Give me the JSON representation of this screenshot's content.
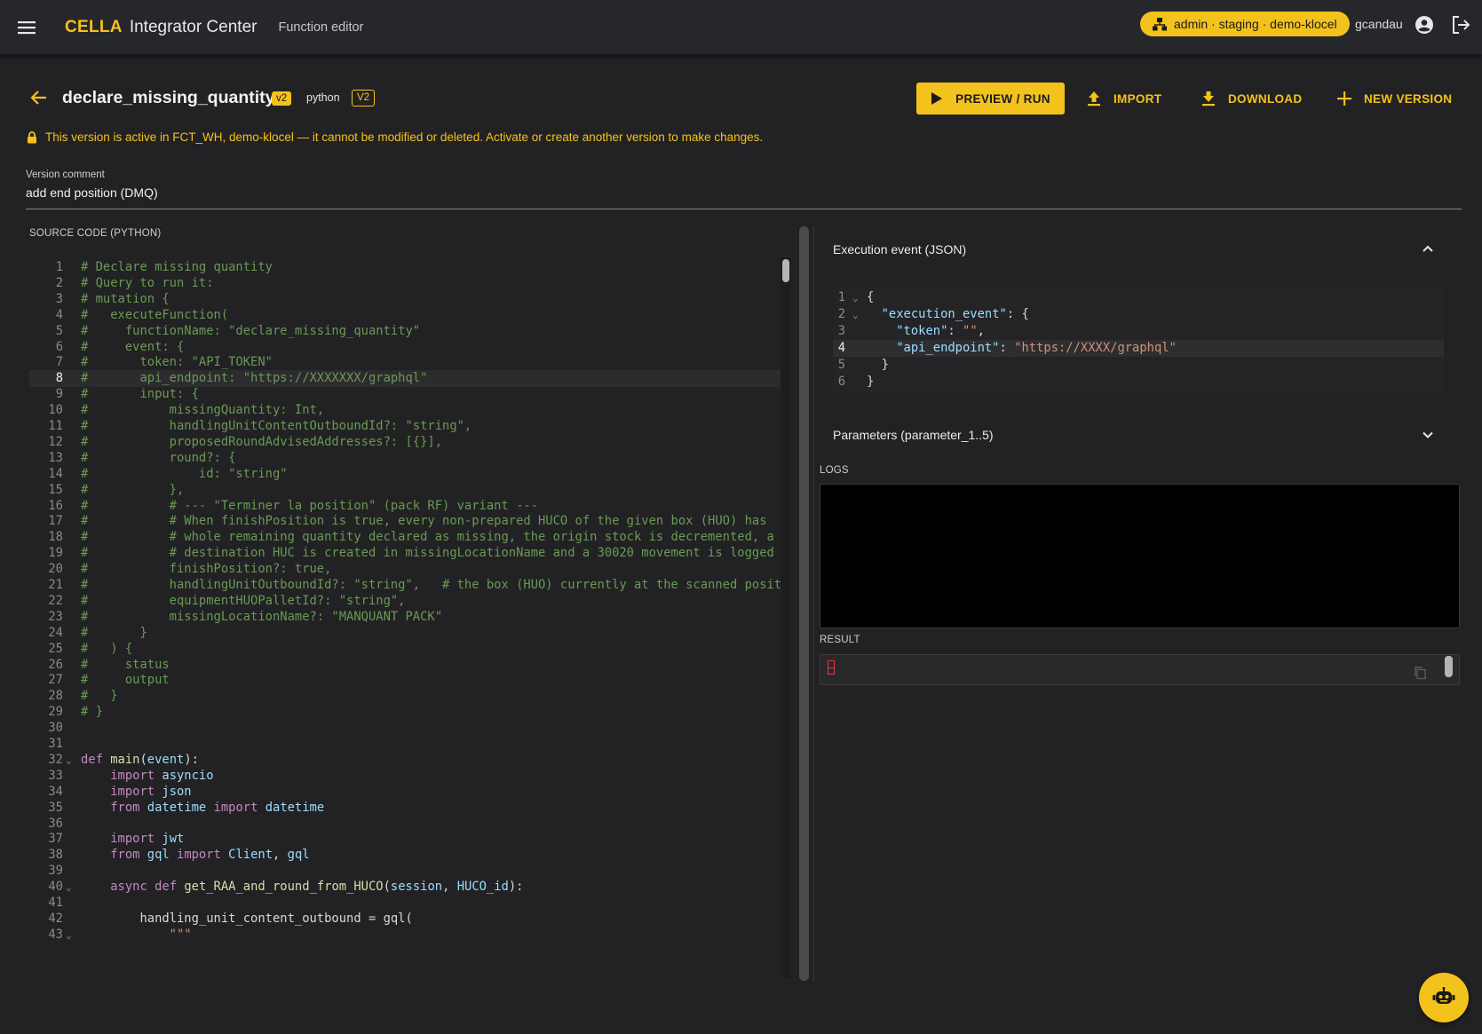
{
  "topbar": {
    "brand_strong": "CELLA",
    "brand_rest": "Integrator Center",
    "subtitle": "Function editor",
    "env_badge": "admin · staging · demo-klocel",
    "username": "gcandau"
  },
  "header": {
    "function_name": "declare_missing_quantity",
    "version_badge": "v2",
    "language": "python",
    "version_label": "V2",
    "buttons": {
      "run": "PREVIEW / RUN",
      "import": "IMPORT",
      "download": "DOWNLOAD",
      "new_version": "NEW VERSION"
    }
  },
  "warning": "This version is active in FCT_WH, demo-klocel — it cannot be modified or deleted. Activate or create another version to make changes.",
  "version_comment": {
    "label": "Version comment",
    "value": "add end position (DMQ)"
  },
  "source": {
    "label": "SOURCE CODE (PYTHON)",
    "active_line": 8,
    "lines": [
      {
        "n": "1",
        "fold": "",
        "t": "# Declare missing quantity",
        "k": "comment"
      },
      {
        "n": "2",
        "fold": "",
        "t": "# Query to run it:",
        "k": "comment"
      },
      {
        "n": "3",
        "fold": "",
        "t": "# mutation {",
        "k": "comment"
      },
      {
        "n": "4",
        "fold": "",
        "t": "#   executeFunction(",
        "k": "comment"
      },
      {
        "n": "5",
        "fold": "",
        "t": "#     functionName: \"declare_missing_quantity\"",
        "k": "comment"
      },
      {
        "n": "6",
        "fold": "",
        "t": "#     event: {",
        "k": "comment"
      },
      {
        "n": "7",
        "fold": "",
        "t": "#       token: \"API_TOKEN\"",
        "k": "comment"
      },
      {
        "n": "8",
        "fold": "",
        "t": "#       api_endpoint: \"https://XXXXXXX/graphql\"",
        "k": "comment"
      },
      {
        "n": "9",
        "fold": "",
        "t": "#       input: {",
        "k": "comment"
      },
      {
        "n": "10",
        "fold": "",
        "t": "#           missingQuantity: Int,",
        "k": "comment"
      },
      {
        "n": "11",
        "fold": "",
        "t": "#           handlingUnitContentOutboundId?: \"string\",",
        "k": "comment"
      },
      {
        "n": "12",
        "fold": "",
        "t": "#           proposedRoundAdvisedAddresses?: [{}],",
        "k": "comment"
      },
      {
        "n": "13",
        "fold": "",
        "t": "#           round?: {",
        "k": "comment"
      },
      {
        "n": "14",
        "fold": "",
        "t": "#               id: \"string\"",
        "k": "comment"
      },
      {
        "n": "15",
        "fold": "",
        "t": "#           },",
        "k": "comment"
      },
      {
        "n": "16",
        "fold": "",
        "t": "#           # --- \"Terminer la position\" (pack RF) variant ---",
        "k": "comment"
      },
      {
        "n": "17",
        "fold": "",
        "t": "#           # When finishPosition is true, every non-prepared HUCO of the given box (HUO) has",
        "k": "comment"
      },
      {
        "n": "18",
        "fold": "",
        "t": "#           # whole remaining quantity declared as missing, the origin stock is decremented, a",
        "k": "comment"
      },
      {
        "n": "19",
        "fold": "",
        "t": "#           # destination HUC is created in missingLocationName and a 30020 movement is logged",
        "k": "comment"
      },
      {
        "n": "20",
        "fold": "",
        "t": "#           finishPosition?: true,",
        "k": "comment"
      },
      {
        "n": "21",
        "fold": "",
        "t": "#           handlingUnitOutboundId?: \"string\",   # the box (HUO) currently at the scanned position",
        "k": "comment"
      },
      {
        "n": "22",
        "fold": "",
        "t": "#           equipmentHUOPalletId?: \"string\",",
        "k": "comment"
      },
      {
        "n": "23",
        "fold": "",
        "t": "#           missingLocationName?: \"MANQUANT PACK\"",
        "k": "comment"
      },
      {
        "n": "24",
        "fold": "",
        "t": "#       }",
        "k": "comment"
      },
      {
        "n": "25",
        "fold": "",
        "t": "#   ) {",
        "k": "comment"
      },
      {
        "n": "26",
        "fold": "",
        "t": "#     status",
        "k": "comment"
      },
      {
        "n": "27",
        "fold": "",
        "t": "#     output",
        "k": "comment"
      },
      {
        "n": "28",
        "fold": "",
        "t": "#   }",
        "k": "comment"
      },
      {
        "n": "29",
        "fold": "",
        "t": "# }",
        "k": "comment"
      },
      {
        "n": "30",
        "fold": "",
        "t": "",
        "k": "plain"
      },
      {
        "n": "31",
        "fold": "",
        "t": "",
        "k": "plain"
      },
      {
        "n": "32",
        "fold": "⌄",
        "t": "def main(event):",
        "k": "def"
      },
      {
        "n": "33",
        "fold": "",
        "t": "    import asyncio",
        "k": "import"
      },
      {
        "n": "34",
        "fold": "",
        "t": "    import json",
        "k": "import"
      },
      {
        "n": "35",
        "fold": "",
        "t": "    from datetime import datetime",
        "k": "from"
      },
      {
        "n": "36",
        "fold": "",
        "t": "",
        "k": "plain"
      },
      {
        "n": "37",
        "fold": "",
        "t": "    import jwt",
        "k": "import"
      },
      {
        "n": "38",
        "fold": "",
        "t": "    from gql import Client, gql",
        "k": "from"
      },
      {
        "n": "39",
        "fold": "",
        "t": "",
        "k": "plain"
      },
      {
        "n": "40",
        "fold": "⌄",
        "t": "    async def get_RAA_and_round_from_HUCO(session, HUCO_id):",
        "k": "asyncdef"
      },
      {
        "n": "41",
        "fold": "",
        "t": "",
        "k": "plain"
      },
      {
        "n": "42",
        "fold": "",
        "t": "        handling_unit_content_outbound = gql(",
        "k": "plain"
      },
      {
        "n": "43",
        "fold": "⌄",
        "t": "            \"\"\"",
        "k": "string"
      }
    ]
  },
  "execution_event": {
    "title": "Execution event (JSON)",
    "active_line": 4,
    "lines": [
      {
        "n": "1",
        "fold": "⌄",
        "t": "{",
        "k": "plain"
      },
      {
        "n": "2",
        "fold": "⌄",
        "t": "  \"execution_event\": {",
        "k": "key"
      },
      {
        "n": "3",
        "fold": "",
        "t": "    \"token\": \"\",",
        "k": "kv"
      },
      {
        "n": "4",
        "fold": "",
        "t": "    \"api_endpoint\": \"https://XXXX/graphql\"",
        "k": "kv"
      },
      {
        "n": "5",
        "fold": "",
        "t": "  }",
        "k": "plain"
      },
      {
        "n": "6",
        "fold": "",
        "t": "}",
        "k": "plain"
      }
    ]
  },
  "parameters": {
    "title": "Parameters (parameter_1..5)"
  },
  "logs": {
    "label": "LOGS"
  },
  "result": {
    "label": "RESULT"
  },
  "colors": {
    "accent": "#f4c21d",
    "background": "#222224",
    "topbar": "#26272b"
  },
  "icons": [
    "menu-icon",
    "org-icon",
    "account-circle-icon",
    "logout-icon",
    "arrow-back-icon",
    "lock-icon",
    "play-icon",
    "upload-icon",
    "download-icon",
    "plus-icon",
    "chevron-up-icon",
    "chevron-down-icon",
    "copy-icon",
    "robot-icon"
  ]
}
